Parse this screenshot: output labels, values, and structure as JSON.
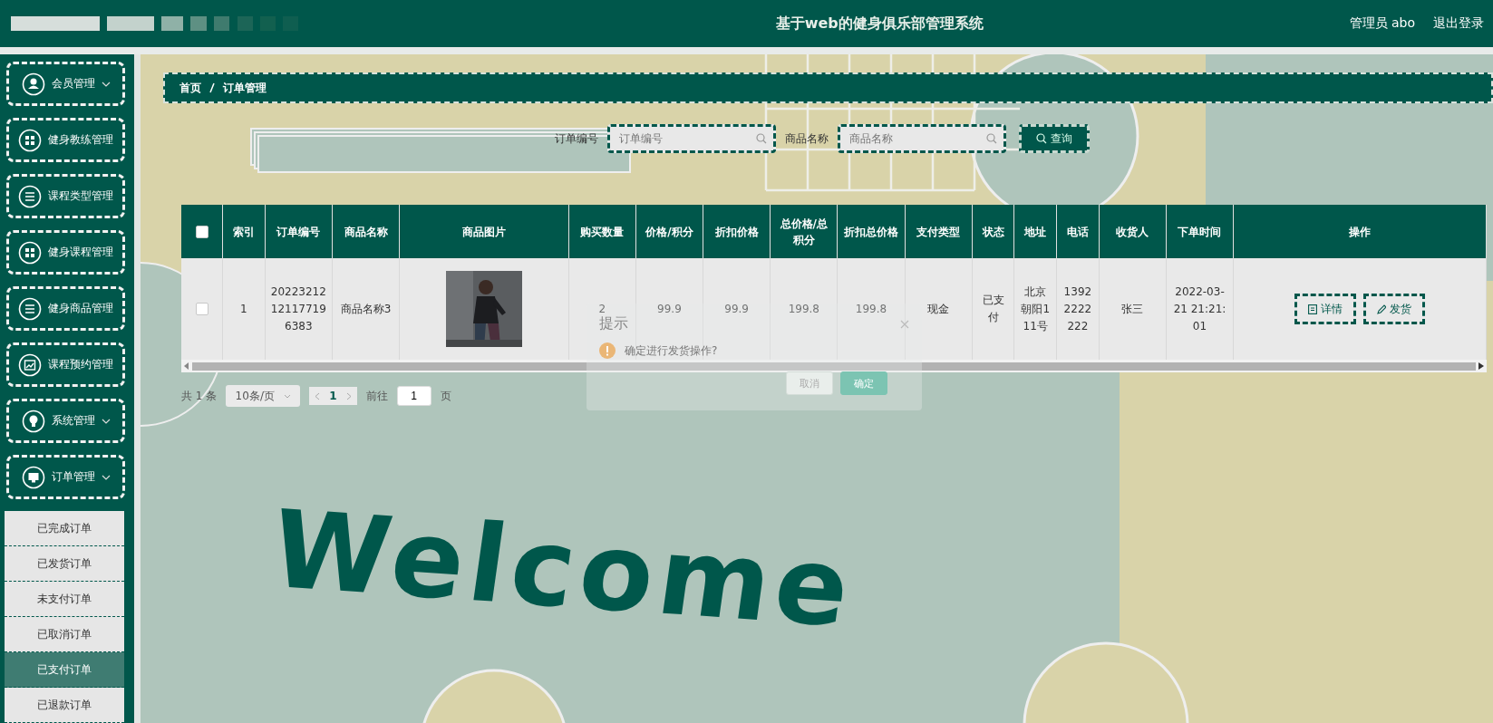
{
  "header": {
    "title": "基于web的健身俱乐部管理系统",
    "user": "管理员 abo",
    "logout": "退出登录"
  },
  "sidebar": {
    "items": [
      {
        "label": "会员管理",
        "has_submenu": true
      },
      {
        "label": "健身教练管理",
        "has_submenu": false
      },
      {
        "label": "课程类型管理",
        "has_submenu": false
      },
      {
        "label": "健身课程管理",
        "has_submenu": false
      },
      {
        "label": "健身商品管理",
        "has_submenu": false
      },
      {
        "label": "课程预约管理",
        "has_submenu": false
      },
      {
        "label": "系统管理",
        "has_submenu": true
      },
      {
        "label": "订单管理",
        "has_submenu": true,
        "children": [
          {
            "label": "已完成订单",
            "selected": false
          },
          {
            "label": "已发货订单",
            "selected": false
          },
          {
            "label": "未支付订单",
            "selected": false
          },
          {
            "label": "已取消订单",
            "selected": false
          },
          {
            "label": "已支付订单",
            "selected": true
          },
          {
            "label": "已退款订单",
            "selected": false
          }
        ]
      }
    ]
  },
  "breadcrumb": [
    "首页",
    "订单管理"
  ],
  "search": {
    "fields": [
      {
        "label": "订单编号",
        "placeholder": "订单编号"
      },
      {
        "label": "商品名称",
        "placeholder": "商品名称"
      }
    ],
    "button": "查询"
  },
  "table": {
    "all_checked": false,
    "columns": [
      "索引",
      "订单编号",
      "商品名称",
      "商品图片",
      "购买数量",
      "价格/积分",
      "折扣价格",
      "总价格/总积分",
      "折扣总价格",
      "支付类型",
      "状态",
      "地址",
      "电话",
      "收货人",
      "下单时间",
      "操作"
    ],
    "rows": [
      {
        "checked": false,
        "cells": [
          {
            "kind": "text",
            "text": "1"
          },
          {
            "kind": "text",
            "text": "20223212121177196383"
          },
          {
            "kind": "text",
            "text": "商品名称3"
          },
          {
            "kind": "picture"
          },
          {
            "kind": "text",
            "text": "2"
          },
          {
            "kind": "text",
            "text": "99.9"
          },
          {
            "kind": "text",
            "text": "99.9"
          },
          {
            "kind": "text",
            "text": "199.8"
          },
          {
            "kind": "text",
            "text": "199.8"
          },
          {
            "kind": "text",
            "text": "现金"
          },
          {
            "kind": "text",
            "text": "已支付"
          },
          {
            "kind": "text",
            "text": "北京朝阳111号"
          },
          {
            "kind": "text",
            "text": "13922222222"
          },
          {
            "kind": "text",
            "text": "张三"
          },
          {
            "kind": "text",
            "text": "2022-03-21 21:21:01"
          },
          {
            "kind": "actions",
            "buttons": [
              "详情",
              "发货"
            ]
          }
        ]
      }
    ]
  },
  "pagination": {
    "total": "共 1 条",
    "page_size": "10条/页",
    "pages": [
      {
        "label": "1",
        "selected": true
      }
    ],
    "goto_label": "前往",
    "goto_value": "1",
    "goto_suffix": "页"
  },
  "dialog": {
    "title": "提示",
    "message": "确定进行发货操作?",
    "buttons": [
      {
        "label": "取消",
        "kind": "secondary"
      },
      {
        "label": "确定",
        "kind": "primary"
      }
    ]
  },
  "welcome": "Welcome"
}
